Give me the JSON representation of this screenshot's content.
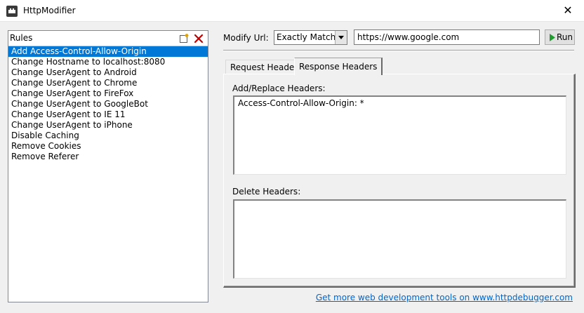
{
  "window": {
    "title": "HttpModifier",
    "close_glyph": "✕"
  },
  "rules": {
    "header_label": "Rules",
    "items": [
      "Add Access-Control-Allow-Origin",
      "Change Hostname to localhost:8080",
      "Change UserAgent to Android",
      "Change UserAgent to Chrome",
      "Change UserAgent to FireFox",
      "Change UserAgent to GoogleBot",
      "Change UserAgent to IE 11",
      "Change UserAgent to iPhone",
      "Disable Caching",
      "Remove Cookies",
      "Remove Referer"
    ],
    "selected_index": 0
  },
  "toolbar": {
    "modify_url_label": "Modify Url:",
    "match_mode": "Exactly Matches",
    "url_value": "https://www.google.com",
    "run_label": "Run"
  },
  "tabs": [
    {
      "label": "Request Headers",
      "active": false
    },
    {
      "label": "Response Headers",
      "active": true
    }
  ],
  "response_headers": {
    "add_label": "Add/Replace Headers:",
    "add_value": "Access-Control-Allow-Origin: *",
    "delete_label": "Delete Headers:",
    "delete_value": ""
  },
  "footer": {
    "link_text": "Get more web development tools on www.httpdebugger.com"
  },
  "colors": {
    "selection": "#0078d7",
    "link": "#0066cc",
    "run_icon": "#1f9e2e",
    "delete_icon": "#c00000"
  },
  "icons": {
    "app": "app-icon",
    "new_rule": "new-rule-icon",
    "delete_rule": "delete-rule-icon",
    "run": "play-icon",
    "dropdown": "chevron-down-icon"
  }
}
